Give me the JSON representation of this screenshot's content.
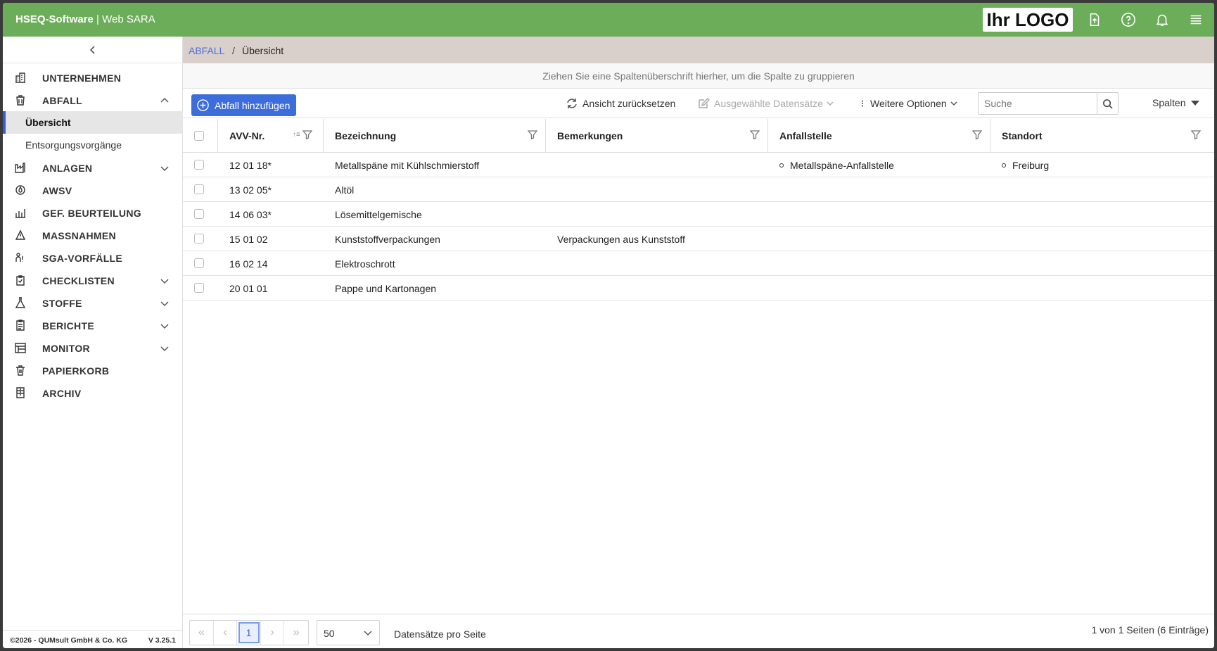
{
  "header": {
    "brand_bold": "HSEQ-Software",
    "brand_rest": " | Web SARA",
    "logo_text": "Ihr LOGO"
  },
  "sidebar": {
    "items": [
      {
        "label": "UNTERNEHMEN",
        "icon": "building-icon",
        "chevron": ""
      },
      {
        "label": "ABFALL",
        "icon": "trash-bag-icon",
        "chevron": "up"
      },
      {
        "label": "ANLAGEN",
        "icon": "factory-icon",
        "chevron": "down"
      },
      {
        "label": "AWSV",
        "icon": "water-drop-icon",
        "chevron": ""
      },
      {
        "label": "GEF. BEURTEILUNG",
        "icon": "bar-chart-icon",
        "chevron": ""
      },
      {
        "label": "MASSNAHMEN",
        "icon": "measures-icon",
        "chevron": ""
      },
      {
        "label": "SGA-VORFÄLLE",
        "icon": "people-incident-icon",
        "chevron": ""
      },
      {
        "label": "CHECKLISTEN",
        "icon": "clipboard-check-icon",
        "chevron": "down"
      },
      {
        "label": "STOFFE",
        "icon": "flask-icon",
        "chevron": "down"
      },
      {
        "label": "BERICHTE",
        "icon": "report-icon",
        "chevron": "down"
      },
      {
        "label": "MONITOR",
        "icon": "monitor-calendar-icon",
        "chevron": "down"
      },
      {
        "label": "PAPIERKORB",
        "icon": "bin-icon",
        "chevron": ""
      },
      {
        "label": "ARCHIV",
        "icon": "archive-icon",
        "chevron": ""
      }
    ],
    "sub_items": [
      {
        "label": "Übersicht",
        "active": true
      },
      {
        "label": "Entsorgungsvorgänge",
        "active": false
      }
    ],
    "footer_copyright": "©2026 - QUMsult GmbH & Co. KG",
    "footer_version": "V 3.25.1"
  },
  "breadcrumb": {
    "parent": "ABFALL",
    "separator": "/",
    "current": "Übersicht"
  },
  "group_hint": "Ziehen Sie eine Spaltenüberschrift hierher, um die Spalte zu gruppieren",
  "toolbar": {
    "add_label": "Abfall hinzufügen",
    "reset_label": "Ansicht zurücksetzen",
    "selected_label": "Ausgewählte Datensätze",
    "more_label": "Weitere Optionen",
    "search_placeholder": "Suche",
    "columns_label": "Spalten"
  },
  "table": {
    "columns": [
      "AVV-Nr.",
      "Bezeichnung",
      "Bemerkungen",
      "Anfallstelle",
      "Standort"
    ],
    "rows": [
      {
        "avv": "12 01 18*",
        "bezeichnung": "Metallspäne mit Kühlschmierstoff",
        "bemerkungen": "",
        "anfallstelle": "Metallspäne-Anfallstelle",
        "standort": "Freiburg"
      },
      {
        "avv": "13 02 05*",
        "bezeichnung": "Altöl",
        "bemerkungen": "",
        "anfallstelle": "",
        "standort": ""
      },
      {
        "avv": "14 06 03*",
        "bezeichnung": "Lösemittelgemische",
        "bemerkungen": "",
        "anfallstelle": "",
        "standort": ""
      },
      {
        "avv": "15 01 02",
        "bezeichnung": "Kunststoffverpackungen",
        "bemerkungen": "Verpackungen aus Kunststoff",
        "anfallstelle": "",
        "standort": ""
      },
      {
        "avv": "16 02 14",
        "bezeichnung": "Elektroschrott",
        "bemerkungen": "",
        "anfallstelle": "",
        "standort": ""
      },
      {
        "avv": "20 01 01",
        "bezeichnung": "Pappe und Kartonagen",
        "bemerkungen": "",
        "anfallstelle": "",
        "standort": ""
      }
    ]
  },
  "pager": {
    "current_page": "1",
    "page_size": "50",
    "page_size_label": "Datensätze pro Seite",
    "info": "1 von 1 Seiten (6 Einträge)"
  },
  "colors": {
    "topbar": "#6cad5a",
    "accent": "#3d6ddb",
    "breadcrumb_bg": "#d9cfcb"
  }
}
